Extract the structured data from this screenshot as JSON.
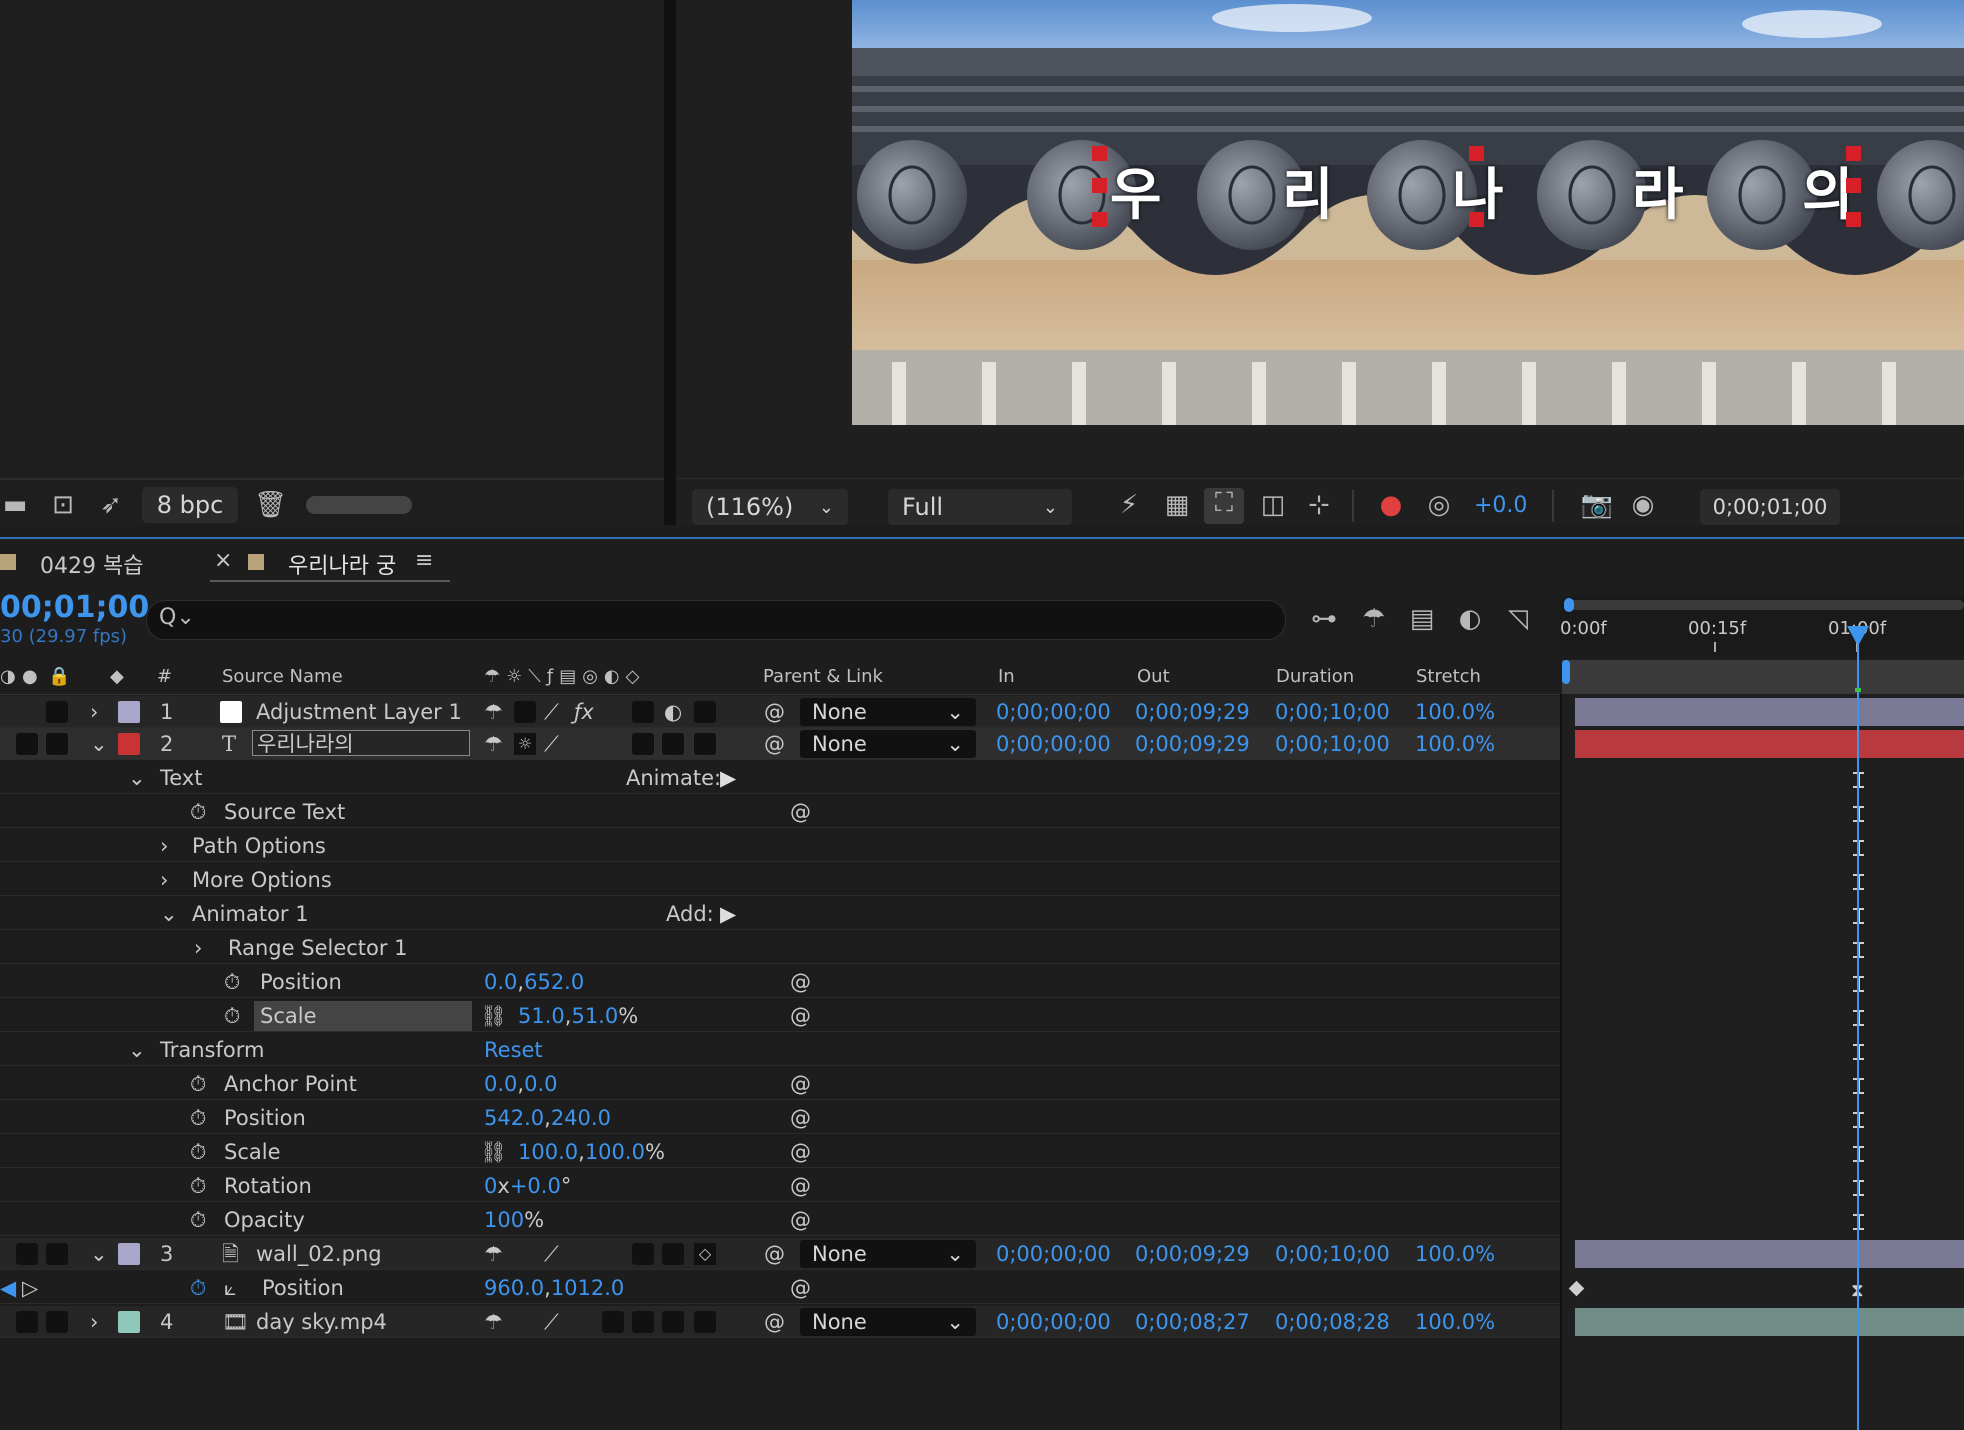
{
  "project_panel": {
    "bpc": "8 bpc"
  },
  "viewer": {
    "caption_chars": [
      "우",
      "리",
      "나",
      "라",
      "의"
    ],
    "zoom": "(116%)",
    "resolution": "Full",
    "exposure": "+0.0",
    "timecode": "0;00;01;00"
  },
  "tabs": [
    {
      "label": "0429 복습"
    },
    {
      "label": "우리나라 궁",
      "close": "×",
      "menu": "≡"
    }
  ],
  "timeline": {
    "current_time": "00;01;00",
    "fps": "30 (29.97 fps)",
    "search_icon": "Q⌄",
    "ruler": [
      "0:00f",
      "00:15f",
      "01:00f"
    ],
    "headers": {
      "num": "#",
      "source": "Source Name",
      "parent": "Parent & Link",
      "in": "In",
      "out": "Out",
      "duration": "Duration",
      "stretch": "Stretch"
    },
    "layers": [
      {
        "num": "1",
        "name": "Adjustment Layer 1",
        "parent": "None",
        "in": "0;00;00;00",
        "out": "0;00;09;29",
        "duration": "0;00;10;00",
        "stretch": "100.0%",
        "color": "#a9a7c9"
      },
      {
        "num": "2",
        "name": "우리나라의",
        "parent": "None",
        "in": "0;00;00;00",
        "out": "0;00;09;29",
        "duration": "0;00;10;00",
        "stretch": "100.0%",
        "color": "#c83333"
      },
      {
        "num": "3",
        "name": "wall_02.png",
        "parent": "None",
        "in": "0;00;00;00",
        "out": "0;00;09;29",
        "duration": "0;00;10;00",
        "stretch": "100.0%",
        "color": "#a9a7c9"
      },
      {
        "num": "4",
        "name": "day sky.mp4",
        "parent": "None",
        "in": "0;00;00;00",
        "out": "0;00;08;27",
        "duration": "0;00;08;28",
        "stretch": "100.0%",
        "color": "#8fc7bb"
      }
    ],
    "props": {
      "text": "Text",
      "animate": "Animate:",
      "source_text": "Source Text",
      "path_options": "Path Options",
      "more_options": "More Options",
      "animator": "Animator 1",
      "add": "Add:",
      "range_selector": "Range Selector 1",
      "anim_position_label": "Position",
      "anim_position": [
        "0.0",
        ",",
        "652.0"
      ],
      "anim_scale_label": "Scale",
      "anim_scale": [
        "51.0",
        ",",
        "51.0",
        "%"
      ],
      "transform": "Transform",
      "reset": "Reset",
      "anchor_label": "Anchor Point",
      "anchor": [
        "0.0",
        ",",
        "0.0"
      ],
      "position_label": "Position",
      "position": [
        "542.0",
        ",",
        "240.0"
      ],
      "scale_label": "Scale",
      "scale": [
        "100.0",
        ",",
        "100.0",
        "%"
      ],
      "rotation_label": "Rotation",
      "rotation": [
        "0",
        "x",
        "+0.0",
        "°"
      ],
      "opacity_label": "Opacity",
      "opacity": [
        "100",
        "%"
      ],
      "wall_position_label": "Position",
      "wall_position": [
        "960.0",
        ",",
        "1012.0"
      ]
    }
  }
}
